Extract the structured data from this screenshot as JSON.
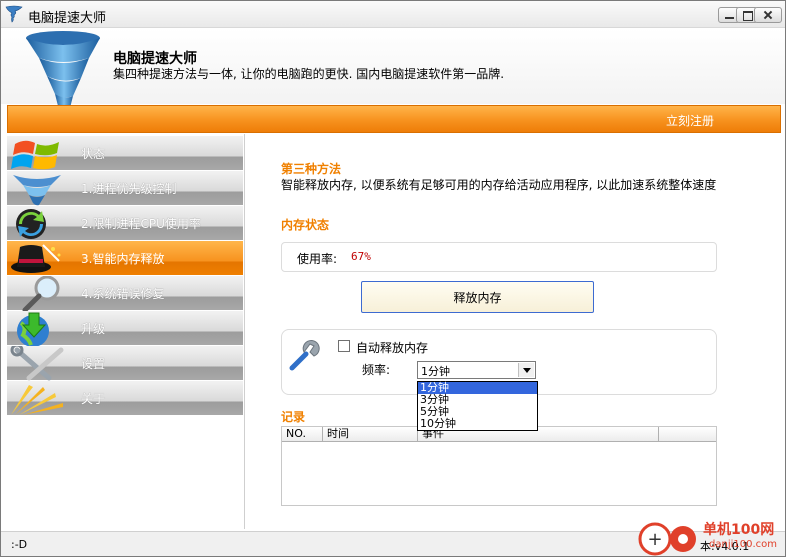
{
  "window": {
    "title": "电脑提速大师"
  },
  "banner": {
    "brand": "电脑提速大师",
    "slogan": "集四种提速方法与一体, 让你的电脑跑的更快. 国内电脑提速软件第一品牌."
  },
  "toolbar": {
    "register_label": "立刻注册"
  },
  "sidebar": {
    "items": [
      {
        "label": "状态",
        "icon": "windows-logo-icon"
      },
      {
        "label": "1.进程优先级控制",
        "icon": "tornado-icon"
      },
      {
        "label": "2.限制进程CPU使用率",
        "icon": "refresh-arrows-icon"
      },
      {
        "label": "3.智能内存释放",
        "icon": "magic-hat-icon",
        "active": true
      },
      {
        "label": "4.系统错误修复",
        "icon": "magnifier-icon"
      },
      {
        "label": "升级",
        "icon": "globe-download-icon"
      },
      {
        "label": "设置",
        "icon": "tools-icon"
      },
      {
        "label": "关于",
        "icon": "light-rays-icon"
      }
    ]
  },
  "main": {
    "method_title": "第三种方法",
    "method_desc": "智能释放内存, 以便系统有足够可用的内存给活动应用程序, 以此加速系统整体速度",
    "memory_title": "内存状态",
    "usage_label": "使用率:",
    "usage_value": "67%",
    "release_button": "释放内存",
    "auto_release_label": "自动释放内存",
    "auto_release_checked": false,
    "frequency_label": "频率:",
    "frequency_selected": "1分钟",
    "frequency_options": [
      "1分钟",
      "3分钟",
      "5分钟",
      "10分钟"
    ],
    "log_title": "记录",
    "log_columns": [
      "NO.",
      "时间",
      "事件"
    ]
  },
  "status": {
    "left_text": ":-D",
    "version_text": "本:v4.0.1"
  },
  "watermark": {
    "text": "单机100网",
    "url": "danji100.com"
  },
  "colors": {
    "accent_orange": "#f7921e",
    "section_title": "#f08000",
    "usage_value": "#c00000",
    "selected_option": "#3366dd"
  }
}
